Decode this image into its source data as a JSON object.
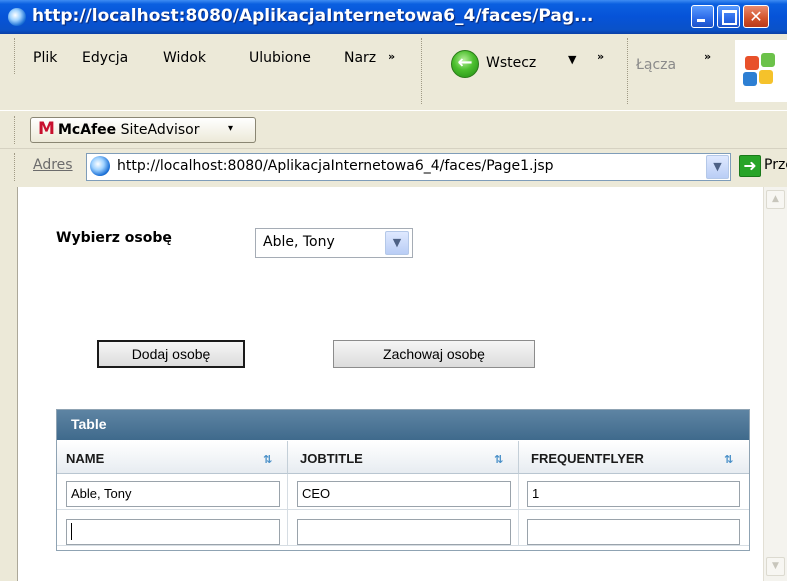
{
  "window": {
    "title": "http://localhost:8080/AplikacjaInternetowa6_4/faces/Pag...",
    "close_glyph": "✕"
  },
  "menu": {
    "items": [
      "Plik",
      "Edycja",
      "Widok",
      "Ulubione",
      "Narz"
    ],
    "chevron": "»"
  },
  "toolbar": {
    "back_label": "Wstecz",
    "back_arrow": "←",
    "dropdown_glyph": "▼",
    "chevron": "»",
    "links_label": "Łącza"
  },
  "mcafee": {
    "logo_letter": "M",
    "brand": "McAfee",
    "product": "SiteAdvisor",
    "dropdown_glyph": "▾"
  },
  "address": {
    "label": "Adres",
    "url": "http://localhost:8080/AplikacjaInternetowa6_4/faces/Page1.jsp",
    "dropdown_glyph": "▼",
    "go_arrow": "➜",
    "go_label": "Przejdź"
  },
  "form": {
    "choose_label": "Wybierz osobę",
    "selected_person": "Able, Tony",
    "dropdown_glyph": "▼",
    "add_button": "Dodaj osobę",
    "save_button": "Zachowaj osobę"
  },
  "table": {
    "title": "Table",
    "sort_glyph": "⇅",
    "columns": [
      "NAME",
      "JOBTITLE",
      "FREQUENTFLYER"
    ],
    "rows": [
      [
        "Able, Tony",
        "CEO",
        "1"
      ],
      [
        "",
        "",
        ""
      ]
    ]
  },
  "scrollbar": {
    "up_glyph": "▲",
    "down_glyph": "▼"
  },
  "colors": {
    "titlebar_blue": "#0653d8",
    "table_header_blue": "#4f7697",
    "mcafee_red": "#c8102e",
    "go_green": "#28a428"
  }
}
